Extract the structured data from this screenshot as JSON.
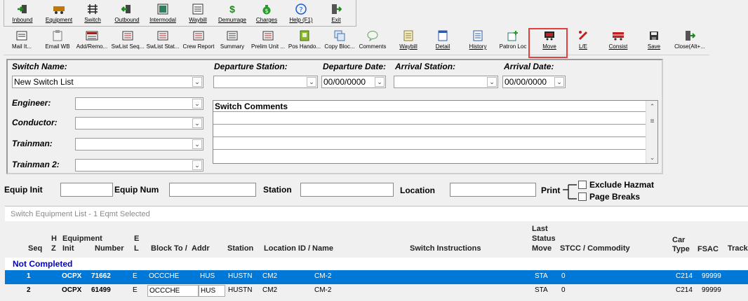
{
  "toolbar_top": [
    {
      "key": "inbound",
      "label": "Inbound",
      "icon": "inbound-icon"
    },
    {
      "key": "equipment",
      "label": "Equipment",
      "icon": "railcar-icon"
    },
    {
      "key": "switch",
      "label": "Switch",
      "icon": "switch-icon"
    },
    {
      "key": "outbound",
      "label": "Outbound",
      "icon": "outbound-icon"
    },
    {
      "key": "intermodal",
      "label": "Intermodal",
      "icon": "intermodal-icon"
    },
    {
      "key": "waybill",
      "label": "Waybill",
      "icon": "waybill-icon"
    },
    {
      "key": "demurrage",
      "label": "Demurrage",
      "icon": "dollar-icon"
    },
    {
      "key": "charges",
      "label": "Charges",
      "icon": "money-bag-icon"
    },
    {
      "key": "help",
      "label": "Help (F1)",
      "icon": "help-icon"
    },
    {
      "key": "exit",
      "label": "Exit",
      "icon": "exit-door-icon"
    }
  ],
  "toolbar_bottom": [
    {
      "key": "mail",
      "label": "Mail It...",
      "icon": "mail-icon"
    },
    {
      "key": "email_wb",
      "label": "Email WB",
      "icon": "clipboard-icon"
    },
    {
      "key": "add_remove",
      "label": "Add/Remo...",
      "icon": "add-remove-icon"
    },
    {
      "key": "swlist_seq",
      "label": "SwList Seq...",
      "icon": "report-icon"
    },
    {
      "key": "swlist_stat",
      "label": "SwList Stat...",
      "icon": "report-icon"
    },
    {
      "key": "crew_report",
      "label": "Crew Report",
      "icon": "report-icon"
    },
    {
      "key": "summary",
      "label": "Summary",
      "icon": "report-icon"
    },
    {
      "key": "prelim_unit",
      "label": "Prelim Unit ...",
      "icon": "report-icon"
    },
    {
      "key": "pos_hando",
      "label": "Pos Hando...",
      "icon": "green-doc-icon"
    },
    {
      "key": "copy_bloc",
      "label": "Copy Bloc...",
      "icon": "copy-icon"
    },
    {
      "key": "comments",
      "label": "Comments",
      "icon": "comment-icon"
    },
    {
      "key": "waybill",
      "label": "Waybill",
      "icon": "waybill-doc-icon"
    },
    {
      "key": "detail",
      "label": "Detail",
      "icon": "detail-icon"
    },
    {
      "key": "history",
      "label": "History",
      "icon": "history-icon"
    },
    {
      "key": "patron_loc",
      "label": "Patron Loc",
      "icon": "patron-loc-icon"
    },
    {
      "key": "move",
      "label": "Move",
      "icon": "move-icon"
    },
    {
      "key": "le",
      "label": "L/E",
      "icon": "le-icon"
    },
    {
      "key": "consist",
      "label": "Consist",
      "icon": "consist-icon"
    },
    {
      "key": "save",
      "label": "Save",
      "icon": "save-icon"
    },
    {
      "key": "close",
      "label": "Close(Alt+...",
      "icon": "close-door-icon"
    }
  ],
  "form": {
    "switch_name_label": "Switch Name:",
    "switch_name_value": "New Switch List",
    "departure_station_label": "Departure Station:",
    "departure_station_value": "",
    "departure_date_label": "Departure Date:",
    "departure_date_value": "00/00/0000",
    "arrival_station_label": "Arrival Station:",
    "arrival_station_value": "",
    "arrival_date_label": "Arrival Date:",
    "arrival_date_value": "00/00/0000",
    "engineer_label": "Engineer:",
    "conductor_label": "Conductor:",
    "trainman_label": "Trainman:",
    "trainman2_label": "Trainman 2:",
    "comments_title": "Switch Comments"
  },
  "search": {
    "equip_init_label": "Equip Init",
    "equip_num_label": "Equip Num",
    "station_label": "Station",
    "location_label": "Location",
    "print_label": "Print",
    "exclude_hazmat_label": "Exclude Hazmat",
    "page_breaks_label": "Page Breaks"
  },
  "grid": {
    "title": "Switch Equipment List - 1 Eqmt Selected",
    "headers": {
      "seq": "Seq",
      "h": "H",
      "z": "Z",
      "equipment": "Equipment",
      "init": "Init",
      "number": "Number",
      "e": "E",
      "l": "L",
      "block_to": "Block To /",
      "addr": "Addr",
      "station": "Station",
      "location": "Location ID / Name",
      "switch_instructions": "Switch Instructions",
      "last": "Last",
      "status": "Status",
      "move": "Move",
      "stcc": "STCC / Commodity",
      "car": "Car",
      "type": "Type",
      "fsac": "FSAC",
      "track": "Track"
    },
    "group_label": "Not Completed",
    "rows": [
      {
        "seq": "1",
        "init": "OCPX",
        "number": "71662",
        "el": "E",
        "block": "OCCCHE",
        "addr": "HUS",
        "station": "HUSTN",
        "loc": "CM2",
        "name": "CM-2",
        "status": "STA",
        "stcc": "0",
        "type": "C214",
        "fsac": "99999",
        "selected": true
      },
      {
        "seq": "2",
        "init": "OCPX",
        "number": "61499",
        "el": "E",
        "block": "OCCCHE",
        "addr": "HUS",
        "station": "HUSTN",
        "loc": "CM2",
        "name": "CM-2",
        "status": "STA",
        "stcc": "0",
        "type": "C214",
        "fsac": "99999",
        "selected": false
      }
    ]
  },
  "colors": {
    "selection": "#0078d7",
    "group_label": "#0000cc",
    "highlight_box": "#e04040"
  }
}
